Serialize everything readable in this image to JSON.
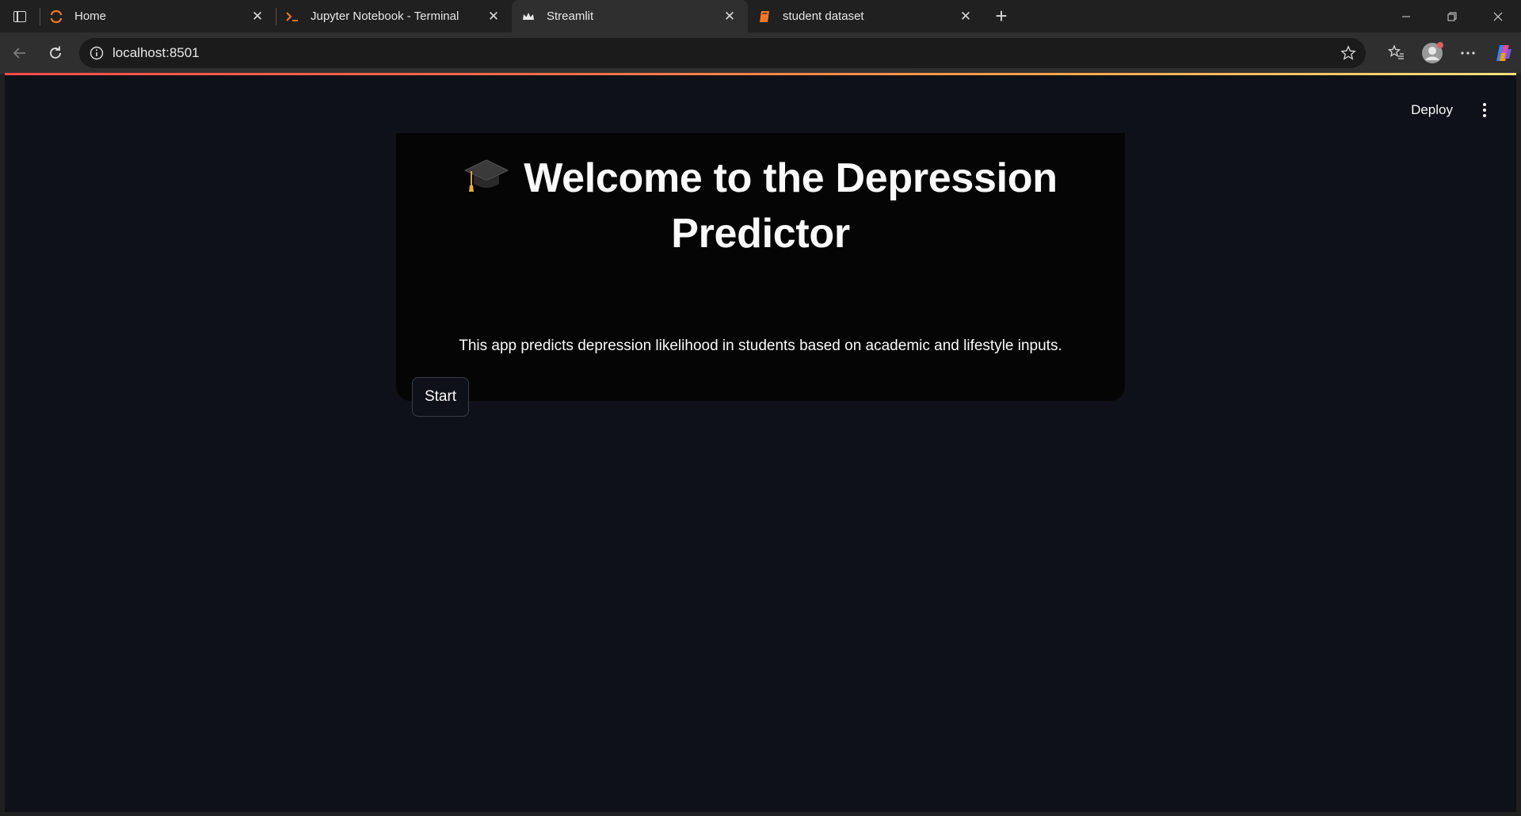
{
  "browser": {
    "tabs": [
      {
        "title": "Home",
        "icon": "jupyter-icon",
        "active": false
      },
      {
        "title": "Jupyter Notebook - Terminal",
        "icon": "terminal-icon",
        "active": false
      },
      {
        "title": "Streamlit",
        "icon": "streamlit-crown-icon",
        "active": true
      },
      {
        "title": "student dataset",
        "icon": "book-icon",
        "active": false
      }
    ],
    "address": "localhost:8501"
  },
  "app": {
    "header": {
      "deploy_label": "Deploy"
    },
    "title": "Welcome to the Depression Predictor",
    "title_icon": "graduation-cap-icon",
    "description": "This app predicts depression likelihood in students based on academic and lifestyle inputs.",
    "start_button": "Start"
  },
  "colors": {
    "app_background": "#0e1117",
    "card_background": "#050505",
    "loadbar_start": "#ff4b4b",
    "loadbar_end": "#ffe27a"
  }
}
